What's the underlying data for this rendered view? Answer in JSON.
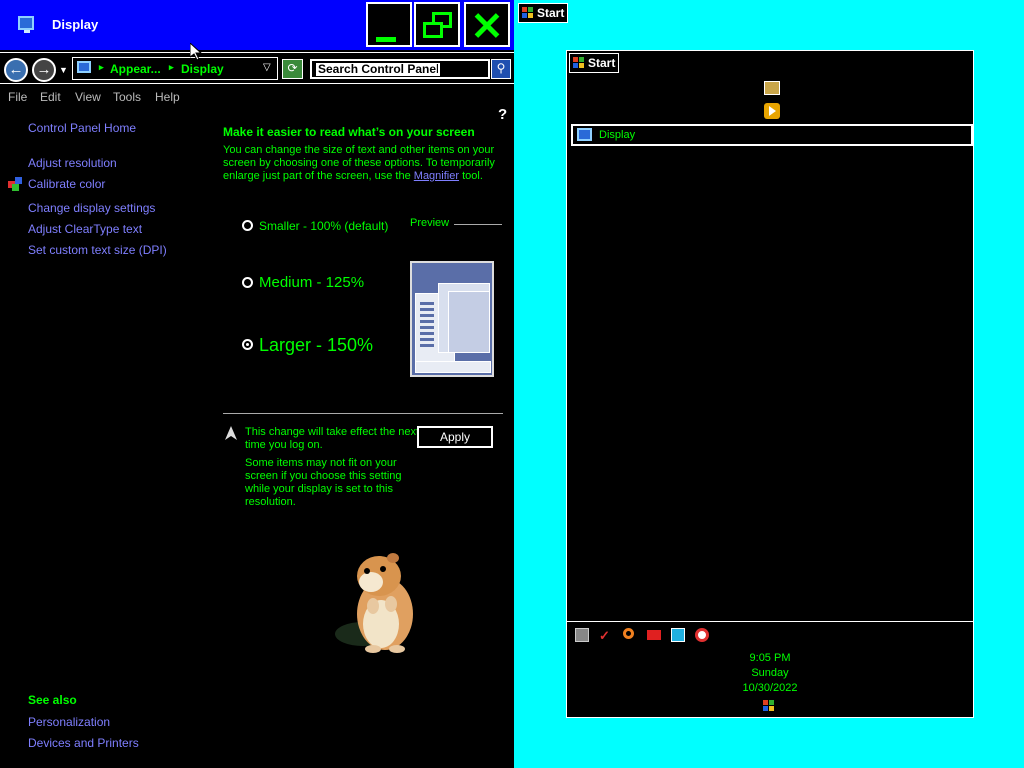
{
  "window": {
    "title": "Display",
    "controls": {
      "minimize": "minimize",
      "maximize": "restore",
      "close": "close"
    }
  },
  "address": {
    "crumbs": [
      "Appear...",
      "Display"
    ],
    "search_placeholder": "Search Control Panel"
  },
  "menu": [
    "File",
    "Edit",
    "View",
    "Tools",
    "Help"
  ],
  "help_label": "?",
  "sidebar": {
    "home": "Control Panel Home",
    "links": [
      "Adjust resolution",
      "Calibrate color",
      "Change display settings",
      "Adjust ClearType text",
      "Set custom text size (DPI)"
    ],
    "see_also_title": "See also",
    "see_also": [
      "Personalization",
      "Devices and Printers"
    ]
  },
  "main": {
    "heading": "Make it easier to read what’s on your screen",
    "description_prefix": "You can change the size of text and other items on your screen by choosing one of these options. To temporarily enlarge just part of the screen, use the ",
    "description_link": "Magnifier",
    "description_suffix": " tool.",
    "options": [
      {
        "label": "Smaller - 100% (default)",
        "checked": false
      },
      {
        "label": "Medium - 125%",
        "checked": false
      },
      {
        "label": "Larger - 150%",
        "checked": true
      }
    ],
    "preview_label": "Preview",
    "note_logon": "This change will take effect the next time you log on.",
    "note_fit": "Some items may not fit on your screen if you choose this setting while your display is set to this resolution.",
    "apply_label": "Apply"
  },
  "taskbar": {
    "start_label": "Start"
  },
  "panel": {
    "start_label": "Start",
    "item_label": "Display",
    "clock": {
      "time": "9:05 PM",
      "day": "Sunday",
      "date": "10/30/2022"
    }
  },
  "colors": {
    "accent_green": "#00ff00",
    "link_blue": "#7f7fff",
    "titlebar": "#0000ff",
    "desktop": "#00ffff"
  }
}
